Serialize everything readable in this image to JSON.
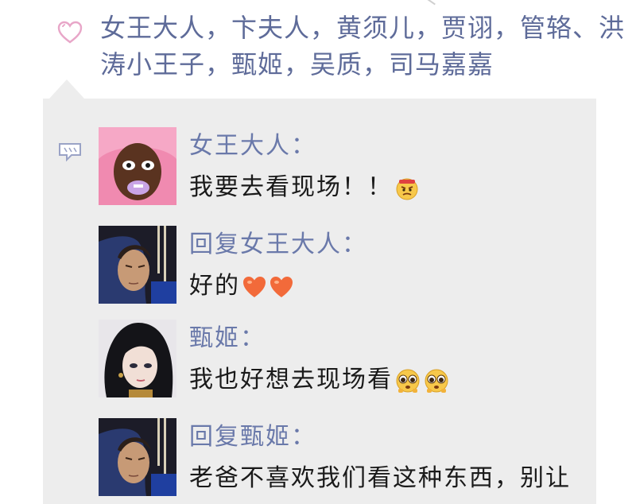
{
  "likes": {
    "icon": "heart-icon",
    "text": "女王大人，卞夫人，黄须儿，贾诩，管辂、洪涛小王子，甄姬，吴质，司马嘉嘉"
  },
  "comments_icon": "comment-icon",
  "comments": [
    {
      "avatar": "avatar-pink-hair",
      "name": "女王大人：",
      "text": "我要去看现场！！",
      "emojis": [
        "angry-face-icon"
      ]
    },
    {
      "avatar": "avatar-warrior",
      "name": "回复女王大人：",
      "text": "好的",
      "emojis": [
        "heart-icon",
        "heart-icon"
      ]
    },
    {
      "avatar": "avatar-dark-hair",
      "name": "甄姬：",
      "text": "我也好想去现场看",
      "emojis": [
        "pleading-face-icon",
        "pleading-face-icon"
      ]
    },
    {
      "avatar": "avatar-warrior",
      "name": "回复甄姬：",
      "text": "老爸不喜欢我们看这种东西，别让",
      "emojis": []
    }
  ],
  "colors": {
    "panel": "#ededed",
    "name": "#6a79aa",
    "likes": "#5e6b99",
    "heart": "#e8a6c8"
  }
}
